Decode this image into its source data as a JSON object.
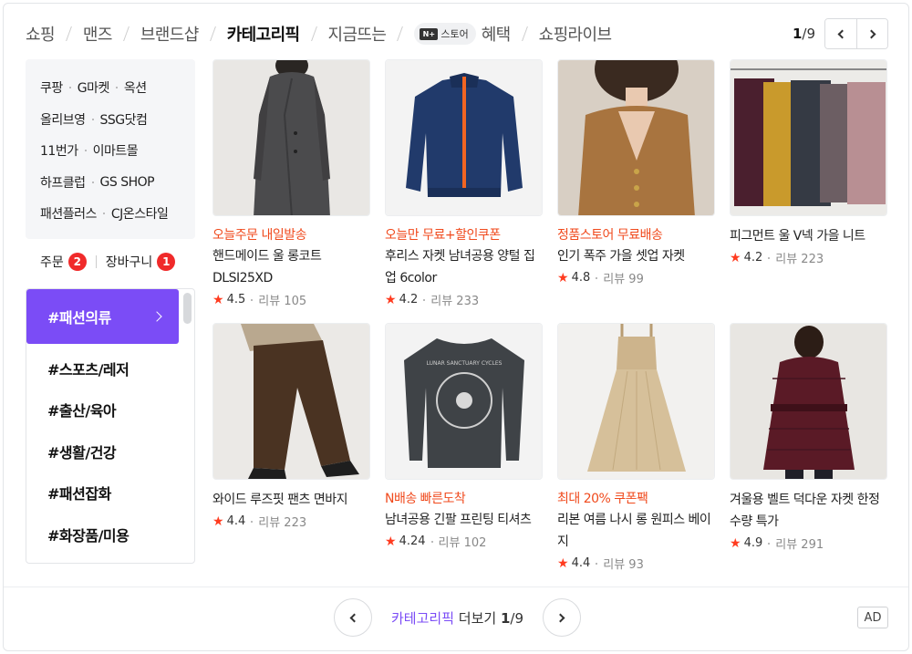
{
  "tabs": [
    {
      "label": "쇼핑"
    },
    {
      "label": "맨즈"
    },
    {
      "label": "브랜드샵"
    },
    {
      "label": "카테고리픽"
    },
    {
      "label": "지금뜨는"
    },
    {
      "label": "혜택",
      "badge": "스토어"
    },
    {
      "label": "쇼핑라이브"
    }
  ],
  "active_tab": "카테고리픽",
  "pager_top": {
    "current": "1",
    "total": "/9"
  },
  "malls": [
    [
      "쿠팡",
      "G마켓",
      "옥션"
    ],
    [
      "올리브영",
      "SSG닷컴"
    ],
    [
      "11번가",
      "이마트몰"
    ],
    [
      "하프클럽",
      "GS SHOP"
    ],
    [
      "패션플러스",
      "CJ온스타일"
    ]
  ],
  "orders": {
    "order_label": "주문",
    "order_count": "2",
    "cart_label": "장바구니",
    "cart_count": "1"
  },
  "categories": [
    "#패션의류",
    "#스포츠/레저",
    "#출산/육아",
    "#생활/건강",
    "#패션잡화",
    "#화장품/미용"
  ],
  "products": [
    {
      "promo": "오늘주문 내일발송",
      "name": "핸드메이드 울 롱코트 DLSI25XD",
      "rating": "4.5",
      "review": "리뷰 105"
    },
    {
      "promo": "오늘만 무료+할인쿠폰",
      "name": "후리스 자켓 남녀공용 양털 집업 6color",
      "rating": "4.2",
      "review": "리뷰 233"
    },
    {
      "promo": "정품스토어 무료배송",
      "name": "인기 폭주 가을 셋업 자켓",
      "rating": "4.8",
      "review": "리뷰 99"
    },
    {
      "promo": "",
      "name": "피그먼트 울 V넥 가을 니트",
      "rating": "4.2",
      "review": "리뷰 223"
    },
    {
      "promo": "",
      "name": "와이드 루즈핏 팬츠 면바지",
      "rating": "4.4",
      "review": "리뷰 223"
    },
    {
      "promo": "N배송 빠른도착",
      "name": "남녀공용 긴팔 프린팅 티셔츠",
      "rating": "4.24",
      "review": "리뷰 102"
    },
    {
      "promo": "최대 20% 쿠폰팩",
      "name": "리본 여름 나시 롱 원피스 베이지",
      "rating": "4.4",
      "review": "리뷰 93"
    },
    {
      "promo": "",
      "name": "겨울용 벨트 덕다운 자켓 한정수량 특가",
      "rating": "4.9",
      "review": "리뷰 291"
    }
  ],
  "bottom": {
    "highlight": "카테고리픽",
    "more": " 더보기 ",
    "page": "1",
    "total": "/9"
  },
  "ad_label": "AD",
  "tshirt_print": "LUNAR SANCTUARY CYCLES",
  "colors": {
    "accent": "#7b4cf6",
    "promo": "#f04a1d",
    "badge": "#f02a2a",
    "star": "#ff3b1f"
  }
}
